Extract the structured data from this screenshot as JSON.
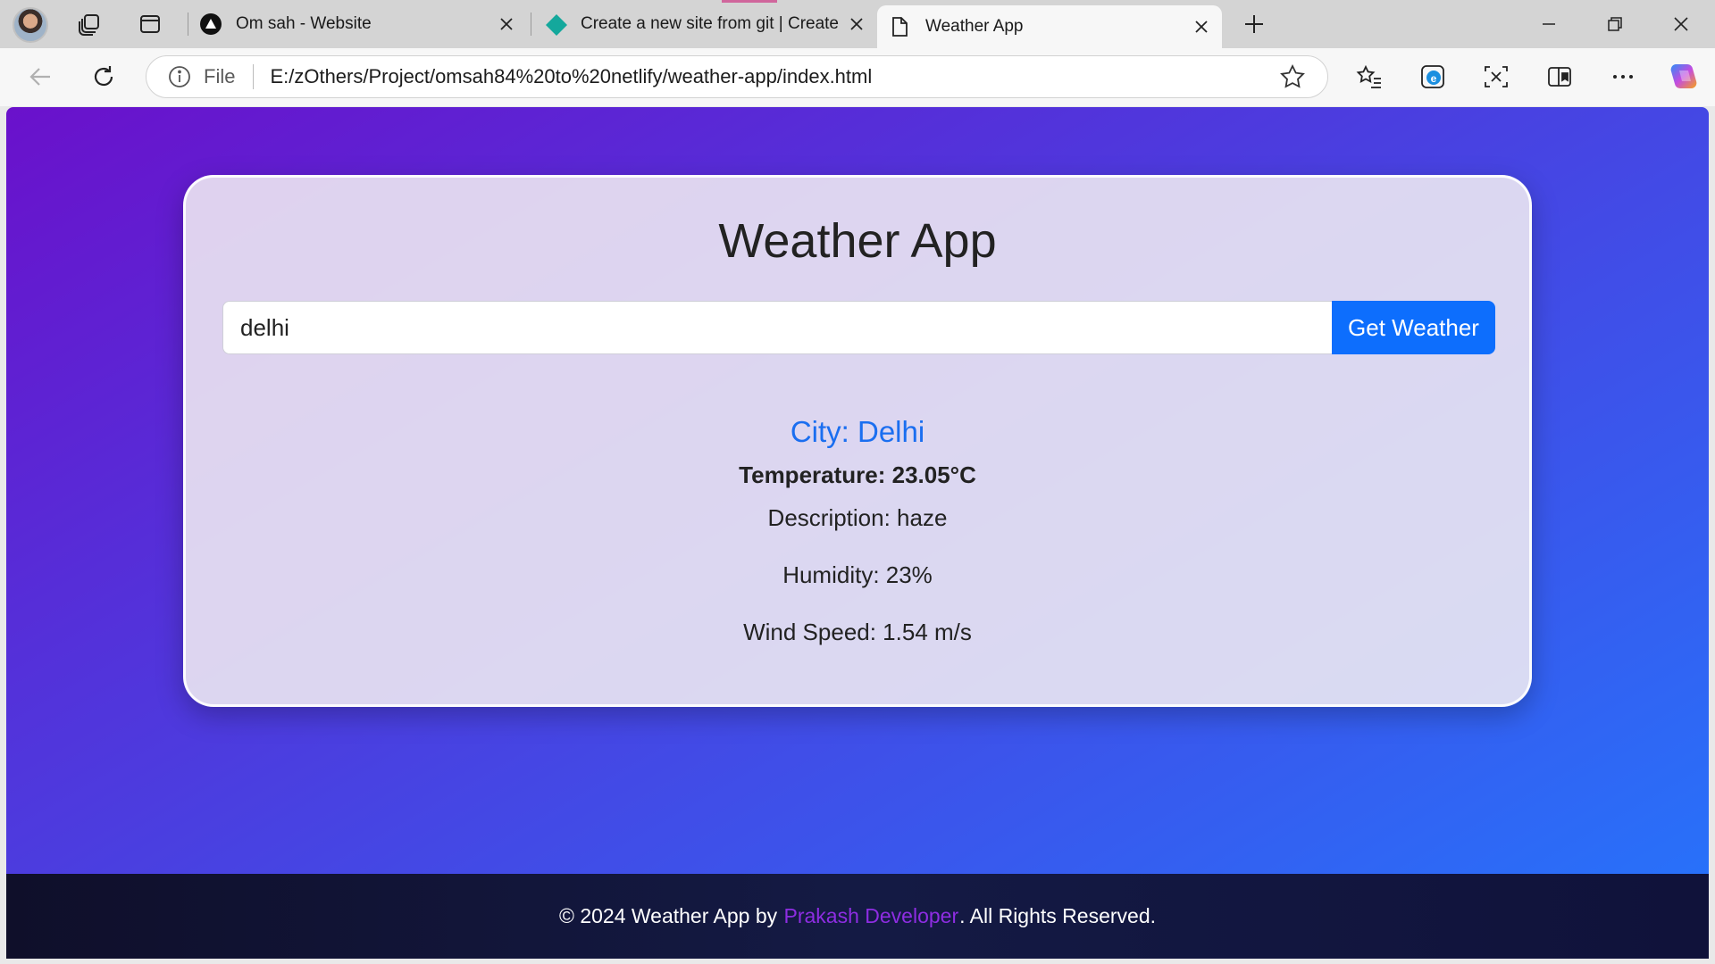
{
  "browser": {
    "tabs": [
      {
        "title": "Om sah - Website",
        "icon": "circle-triangle-icon"
      },
      {
        "title": "Create a new site from git | Create",
        "icon": "netlify-diamond-icon"
      },
      {
        "title": "Weather App",
        "icon": "page-icon",
        "active": true
      }
    ],
    "address_scheme": "File",
    "address_url": "E:/zOthers/Project/omsah84%20to%20netlify/weather-app/index.html"
  },
  "page": {
    "heading": "Weather App",
    "search": {
      "value": "delhi",
      "placeholder": "",
      "button_label": "Get Weather"
    },
    "result": {
      "city": "City: Delhi",
      "temperature": "Temperature: 23.05°C",
      "description": "Description: haze",
      "humidity": "Humidity: 23%",
      "wind": "Wind Speed: 1.54 m/s"
    },
    "footer": {
      "prefix": "© 2024 Weather App by",
      "author": "Prakash Developer",
      "suffix": ". All Rights Reserved."
    }
  },
  "colors": {
    "gradient_start": "#6a11cb",
    "gradient_end": "#2575fc",
    "button": "#0d6efd",
    "city_text": "#1a6ef0",
    "author_link": "#8e2de2"
  }
}
